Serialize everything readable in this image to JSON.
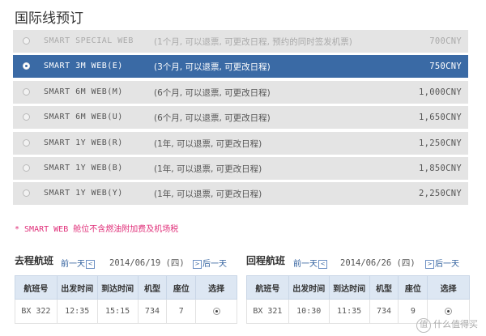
{
  "page_title": "国际线预订",
  "fares": [
    {
      "name": "SMART SPECIAL WEB",
      "desc": "(1个月, 可以退票, 可更改日程, 预约的同时签发机票)",
      "price": "700CNY",
      "state": "disabled"
    },
    {
      "name": "SMART 3M WEB(E)",
      "desc": "(3个月, 可以退票, 可更改日程)",
      "price": "750CNY",
      "state": "selected"
    },
    {
      "name": "SMART 6M WEB(M)",
      "desc": "(6个月, 可以退票, 可更改日程)",
      "price": "1,000CNY",
      "state": "normal"
    },
    {
      "name": "SMART 6M WEB(U)",
      "desc": "(6个月, 可以退票, 可更改日程)",
      "price": "1,650CNY",
      "state": "normal"
    },
    {
      "name": "SMART 1Y WEB(R)",
      "desc": "(1年, 可以退票, 可更改日程)",
      "price": "1,250CNY",
      "state": "normal"
    },
    {
      "name": "SMART 1Y WEB(B)",
      "desc": "(1年, 可以退票, 可更改日程)",
      "price": "1,850CNY",
      "state": "normal"
    },
    {
      "name": "SMART 1Y WEB(Y)",
      "desc": "(1年, 可以退票, 可更改日程)",
      "price": "2,250CNY",
      "state": "normal"
    }
  ],
  "note": "* SMART WEB 舱位不含燃油附加费及机场税",
  "outbound": {
    "title": "去程航班",
    "prev": "前一天",
    "date": "2014/06/19 (四)",
    "next": "后一天",
    "headers": [
      "航班号",
      "出发时间",
      "到达时间",
      "机型",
      "座位",
      "选择"
    ],
    "row": {
      "flight": "BX 322",
      "depart": "12:35",
      "arrive": "15:15",
      "aircraft": "734",
      "seats": "7"
    }
  },
  "return": {
    "title": "回程航班",
    "prev": "前一天",
    "date": "2014/06/26 (四)",
    "next": "后一天",
    "headers": [
      "航班号",
      "出发时间",
      "到达时间",
      "机型",
      "座位",
      "选择"
    ],
    "row": {
      "flight": "BX 321",
      "depart": "10:30",
      "arrive": "11:35",
      "aircraft": "734",
      "seats": "9"
    }
  },
  "watermark": "什么值得买",
  "colors": {
    "accent": "#3a6aa5",
    "note": "#e0307a",
    "table_header": "#dde7f3",
    "row_bg": "#e4e4e4"
  },
  "icons": {
    "radio": "radio-button",
    "prev": "chevron-left-box",
    "next": "chevron-right-box",
    "watermark": "logo-icon"
  }
}
